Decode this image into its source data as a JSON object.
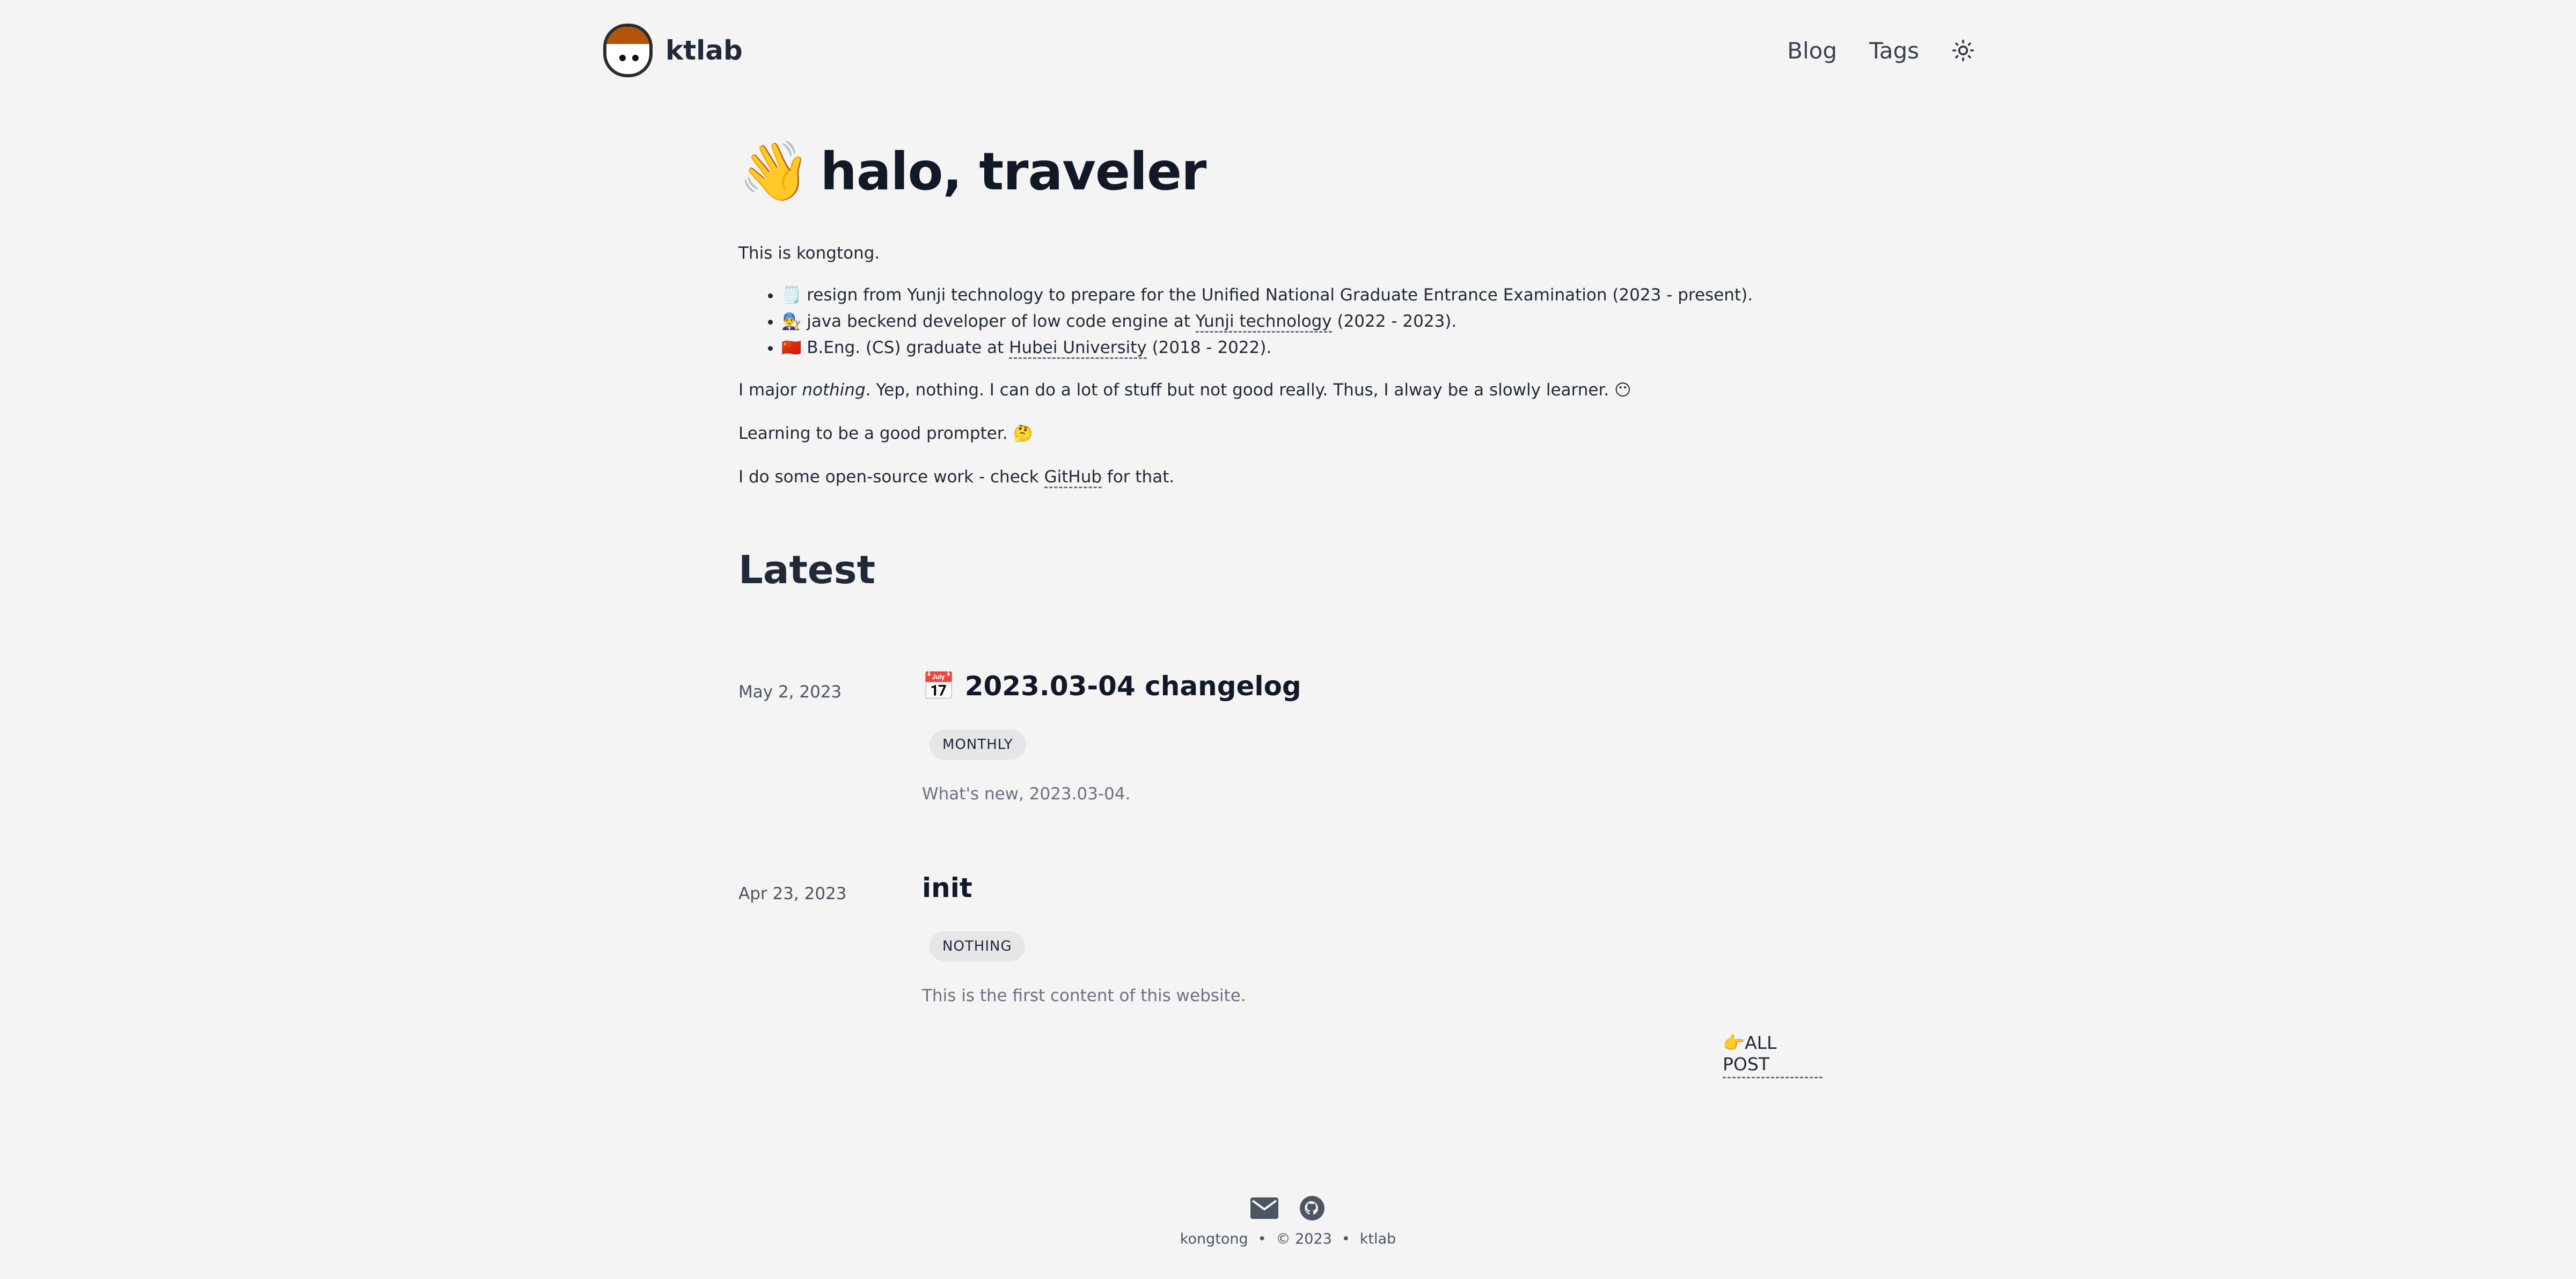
{
  "brand": {
    "name": "ktlab"
  },
  "nav": {
    "blog": "Blog",
    "tags": "Tags"
  },
  "hero": {
    "emoji": "👋",
    "title": "halo, traveler"
  },
  "intro": {
    "line1": "This is kongtong.",
    "items": [
      {
        "emoji": "🗒️",
        "text": "resign from Yunji technology to prepare for the Unified National Graduate Entrance Examination (2023 - present)."
      },
      {
        "emoji": "👨‍🔧",
        "pre": "java beckend developer of low code engine at ",
        "link": "Yunji technology",
        "post": " (2022 - 2023)."
      },
      {
        "emoji": "🇨🇳",
        "pre": "B.Eng. (CS) graduate at ",
        "link": "Hubei University",
        "post": " (2018 - 2022)."
      }
    ],
    "major_pre": "I major ",
    "major_em": "nothing",
    "major_post": ". Yep, nothing. I can do a lot of stuff but not good really. Thus, I alway be a slowly learner. ",
    "major_emoji": "😶",
    "prompter": "Learning to be a good prompter. ",
    "prompter_emoji": "🤔",
    "oss_pre": "I do some open-source work - check ",
    "oss_link": "GitHub",
    "oss_post": " for that."
  },
  "latest": {
    "heading": "Latest",
    "posts": [
      {
        "date": "May 2, 2023",
        "emoji": "📅",
        "title": "2023.03-04 changelog",
        "tag": "MONTHLY",
        "desc": "What's new, 2023.03-04."
      },
      {
        "date": "Apr 23, 2023",
        "emoji": "",
        "title": "init",
        "tag": "NOTHING",
        "desc": "This is the first content of this website."
      }
    ],
    "all_post_emoji": "👉",
    "all_post": "ALL POST"
  },
  "footer": {
    "author": "kongtong",
    "copyright": "© 2023",
    "site": "ktlab"
  },
  "colors": {
    "background": "#f3f4f3",
    "text": "#1f2937",
    "muted": "#6b7280",
    "tag_bg": "#e4e6e8"
  },
  "icons": {
    "theme": "sun-icon",
    "mail": "mail-icon",
    "github": "github-icon"
  }
}
